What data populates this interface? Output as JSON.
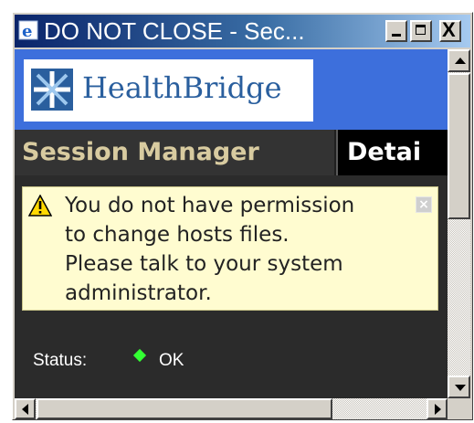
{
  "window": {
    "title": "DO NOT CLOSE - Sec...",
    "icon": "ie-browser-icon",
    "controls": [
      "minimize",
      "maximize",
      "close"
    ],
    "close_glyph": "X"
  },
  "banner": {
    "brand_name": "HealthBridge",
    "logo_icon": "healthbridge-star-logo",
    "background_color": "#3d6fdc"
  },
  "tabs": [
    {
      "label": "Session Manager",
      "active": true
    },
    {
      "label": "Detai",
      "active": false
    }
  ],
  "alert": {
    "icon": "warning-triangle-icon",
    "lines": [
      "You do not have permission",
      "to change hosts files.",
      "Please talk to your system",
      "administrator."
    ],
    "close_glyph": "×",
    "background_color": "#fffcd0"
  },
  "status": {
    "label": "Status:",
    "indicator_color": "#33ff33",
    "value": "OK"
  },
  "colors": {
    "active_tab_text": "#d8cba0",
    "panel_background": "#2b2b2b"
  }
}
